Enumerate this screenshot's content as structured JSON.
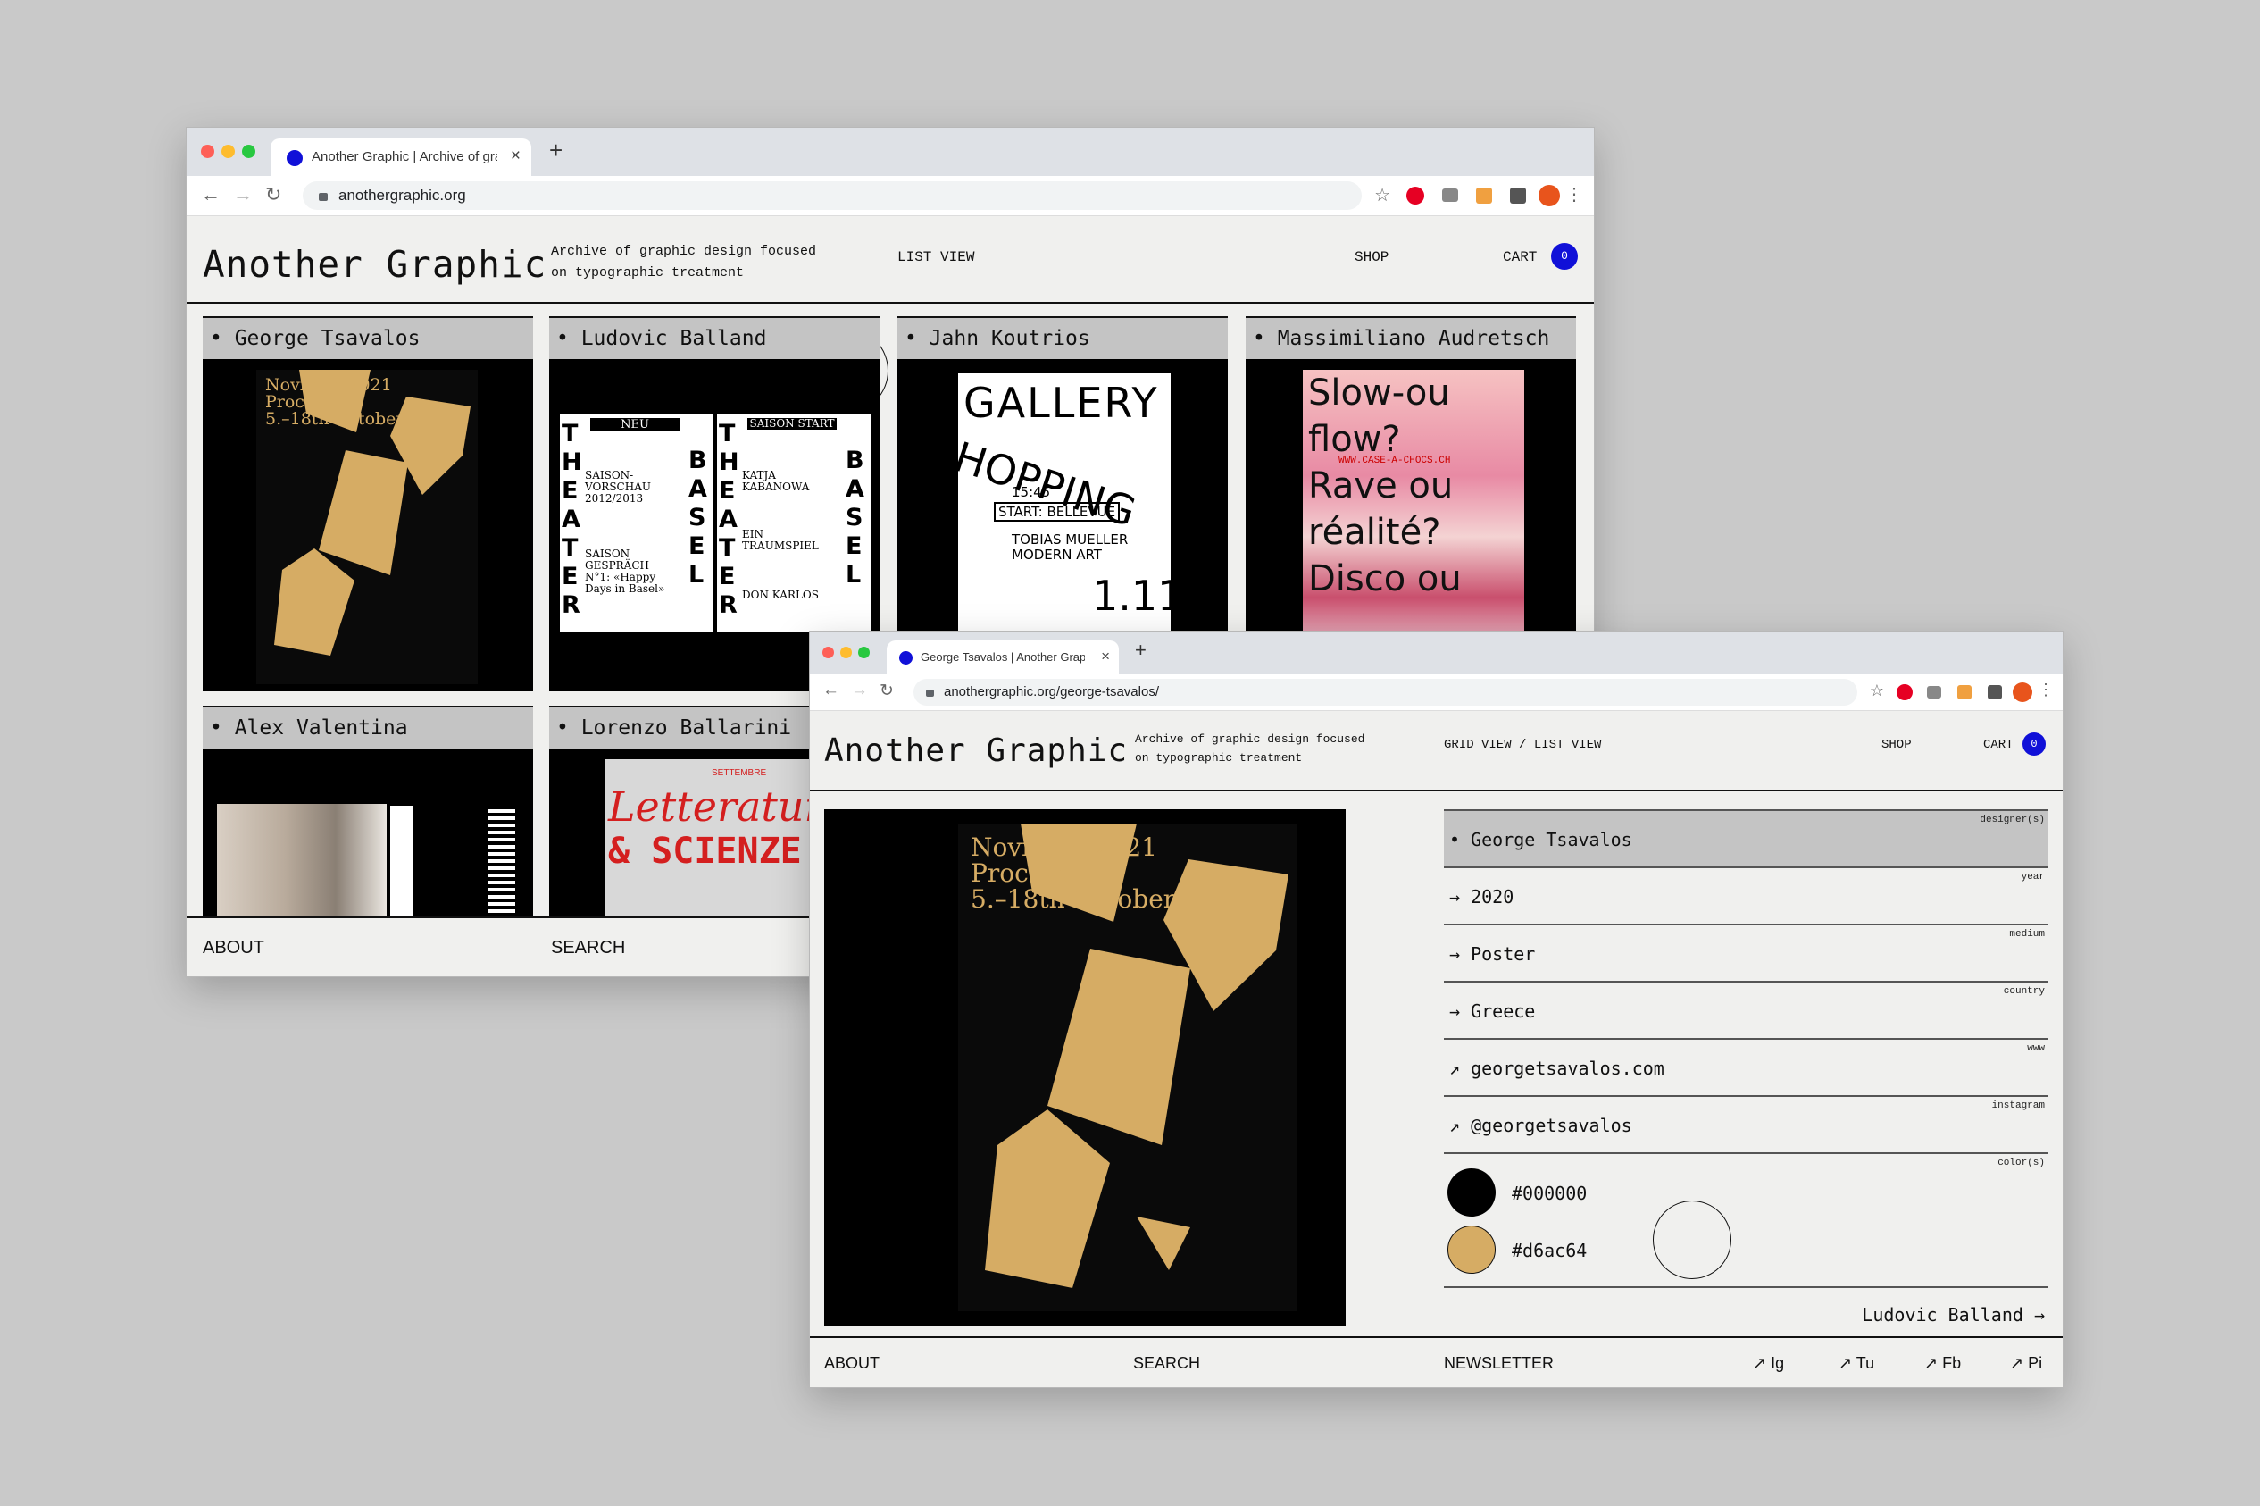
{
  "window_back": {
    "tab": {
      "title": "Another Graphic | Archive of graphic design focused on typographic treatment"
    },
    "address": "anothergraphic.org",
    "header": {
      "logo": "Another Graphic",
      "tagline_line1": "Archive of graphic design focused",
      "tagline_line2": "on typographic treatment",
      "view_link": "LIST VIEW",
      "shop": "SHOP",
      "cart": "CART",
      "cart_count": "0"
    },
    "grid": [
      {
        "name": "George Tsavalos",
        "poster": {
          "l1": "Novi Sad 2021",
          "l2": "Process",
          "l3": "5.–18th October"
        }
      },
      {
        "name": "Ludovic Balland",
        "poster": {
          "a": "NEU",
          "b": "SAISON START",
          "c": "SAISON-VORSCHAU 2012/2013",
          "d": "KATJA KABANOWA",
          "e": "EIN TRAUMSPIEL",
          "f": "DON KARLOS",
          "g": "SAISON GESPRÄCH N°1: «Happy Days in Basel»",
          "vt1": "THEATER",
          "vt2": "BASEL"
        }
      },
      {
        "name": "Jahn Koutrios",
        "poster": {
          "l1": "GALLERY",
          "l2": "HOPPING",
          "l3": "START: BELLEVUE",
          "l4": "TOBIAS MUELLER MODERN ART",
          "l5": "1.11.",
          "l6": "15:45"
        }
      },
      {
        "name": "Massimiliano Audretsch",
        "poster": {
          "l1": "Slow-ou",
          "l2": "flow?",
          "l3": "Rave ou",
          "l4": "réalité?",
          "l5": "Disco ou",
          "l6": "WWW.CASE-A-CHOCS.CH"
        }
      },
      {
        "name": "Alex Valentina",
        "poster": {}
      },
      {
        "name": "Lorenzo Ballarini",
        "poster": {
          "l1": "Letteratura",
          "l2": "& SCIENZE",
          "l3": "SETTEMBRE"
        }
      }
    ],
    "footer": {
      "about": "ABOUT",
      "search": "SEARCH"
    }
  },
  "window_front": {
    "tab": {
      "title": "George Tsavalos | Another Graphic"
    },
    "address": "anothergraphic.org/george-tsavalos/",
    "header": {
      "logo": "Another Graphic",
      "tagline_line1": "Archive of graphic design focused",
      "tagline_line2": "on typographic treatment",
      "grid_view": "GRID VIEW",
      "separator": "/",
      "list_view": "LIST VIEW",
      "shop": "SHOP",
      "cart": "CART",
      "cart_count": "0"
    },
    "poster": {
      "l1": "Novi Sad 2021",
      "l2": "Process",
      "l3": "5.–18th October"
    },
    "meta": [
      {
        "label": "designer(s)",
        "value": "• George Tsavalos"
      },
      {
        "label": "year",
        "value": "→ 2020"
      },
      {
        "label": "medium",
        "value": "→ Poster"
      },
      {
        "label": "country",
        "value": "→ Greece"
      },
      {
        "label": "www",
        "value": "↗ georgetsavalos.com"
      },
      {
        "label": "instagram",
        "value": "↗ @georgetsavalos"
      }
    ],
    "colors": {
      "label": "color(s)",
      "swatches": [
        {
          "hex": "#000000",
          "label": "#000000"
        },
        {
          "hex": "#d6ac64",
          "label": "#d6ac64"
        }
      ]
    },
    "next_link": "Ludovic Balland →",
    "footer": {
      "about": "ABOUT",
      "search": "SEARCH",
      "newsletter": "NEWSLETTER",
      "social": [
        "↗ Ig",
        "↗ Tu",
        "↗ Fb",
        "↗ Pi"
      ]
    }
  },
  "theme": {
    "accent": "#1010d8",
    "gold": "#d6ac64",
    "panel_grey": "#c4c4c4",
    "pinterest": "#e60023",
    "profile": "#e8541c"
  }
}
